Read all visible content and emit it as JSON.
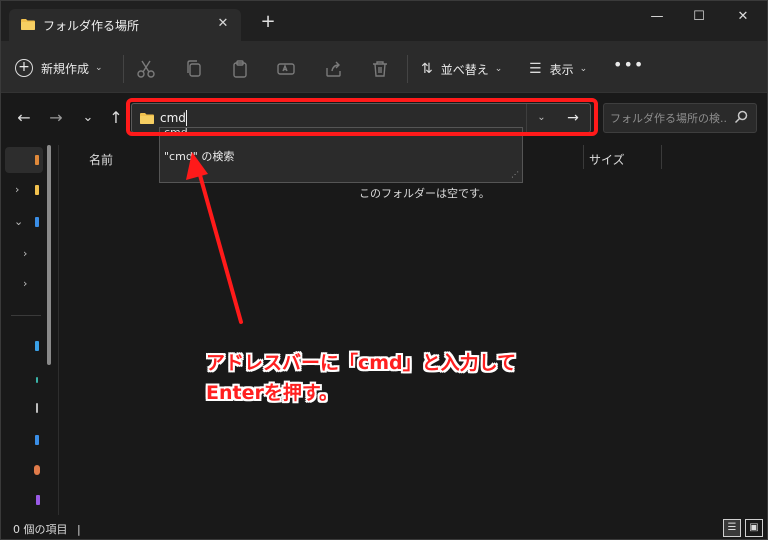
{
  "window": {
    "tab_title": "フォルダ作る場所",
    "tab_close": "✕",
    "new_tab": "+",
    "minimize": "—",
    "maximize": "☐",
    "close": "✕"
  },
  "toolbar": {
    "new_label": "新規作成",
    "sort_label": "並べ替え",
    "view_label": "表示",
    "more": "•••",
    "chevron": "⌄"
  },
  "nav": {
    "back": "←",
    "forward": "→",
    "recent": "⌄",
    "up": "↑"
  },
  "address": {
    "value": "cmd",
    "dropdown": "⌄",
    "go": "→"
  },
  "search": {
    "placeholder": "フォルダ作る場所の検..."
  },
  "suggestions": {
    "item1": "cmd",
    "item2": "\"cmd\" の検索"
  },
  "columns": {
    "name": "名前",
    "size": "サイズ"
  },
  "content": {
    "empty_message": "このフォルダーは空です。"
  },
  "annotation": {
    "line1": "アドレスバーに「cmd」と入力して",
    "line2": "Enterを押す。"
  },
  "status": {
    "item_count": "0 個の項目",
    "divider": "|"
  },
  "colors": {
    "highlight": "#ff1a1a",
    "folder": "#f2c14e",
    "background": "#191919"
  }
}
